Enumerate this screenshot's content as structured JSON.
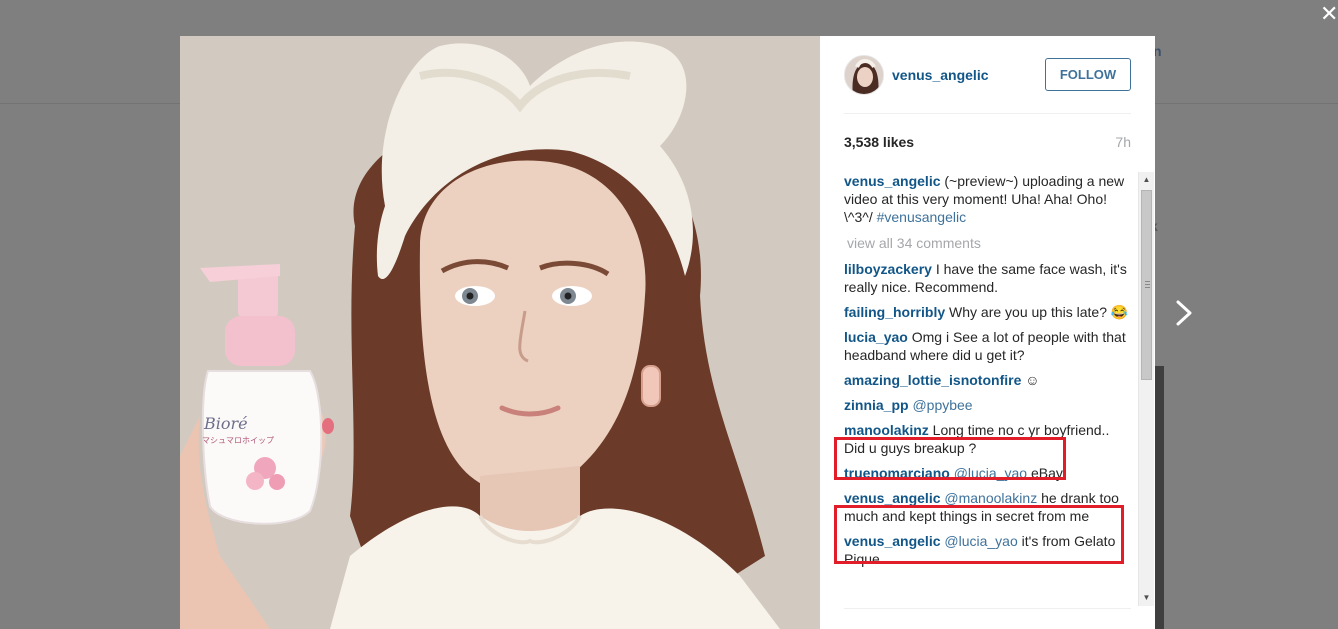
{
  "window": {
    "close_glyph": "✕"
  },
  "background": {
    "partial_text_1": "n",
    "partial_text_2": "k"
  },
  "post": {
    "author": "venus_angelic",
    "follow_label": "FOLLOW",
    "likes": "3,538 likes",
    "time": "7h",
    "caption_author": "venus_angelic",
    "caption_text": " (~preview~) uploading a new video at this very moment! Uha! Aha! Oho! \\^3^/ ",
    "caption_hashtag": "#venusangelic",
    "view_all": "view all 34 comments"
  },
  "photo": {
    "bottle_brand": "Bioré",
    "bottle_subtitle": "マシュマロホイップ"
  },
  "comments": [
    {
      "author": "lilboyzackery",
      "text": " I have the same face wash, it's really nice. Recommend.",
      "mention": "",
      "after": ""
    },
    {
      "author": "failing_horribly",
      "text": " Why are you up this late? 😂",
      "mention": "",
      "after": ""
    },
    {
      "author": "lucia_yao",
      "text": " Omg i See a lot of people with that headband where did u get it?",
      "mention": "",
      "after": ""
    },
    {
      "author": "amazing_lottie_isnotonfire",
      "text": " ☺",
      "mention": "",
      "after": ""
    },
    {
      "author": "zinnia_pp",
      "text": " ",
      "mention": "@ppybee",
      "after": ""
    },
    {
      "author": "manoolakinz",
      "text": " Long time no c yr boyfriend.. Did u guys breakup ?",
      "mention": "",
      "after": ""
    },
    {
      "author": "truenomarciano",
      "text": " ",
      "mention": "@lucia_yao",
      "after": " eBay"
    },
    {
      "author": "venus_angelic",
      "text": " ",
      "mention": "@manoolakinz",
      "after": " he drank too much and kept things in secret from me"
    },
    {
      "author": "venus_angelic",
      "text": " ",
      "mention": "@lucia_yao",
      "after": " it's from Gelato Pique"
    }
  ],
  "colors": {
    "highlight": "#e21d2a",
    "link": "#125688",
    "follow": "#3f729b"
  },
  "icons": {
    "close": "close-icon",
    "next": "chevron-right-icon",
    "scroll_up": "▲",
    "scroll_down": "▼"
  }
}
